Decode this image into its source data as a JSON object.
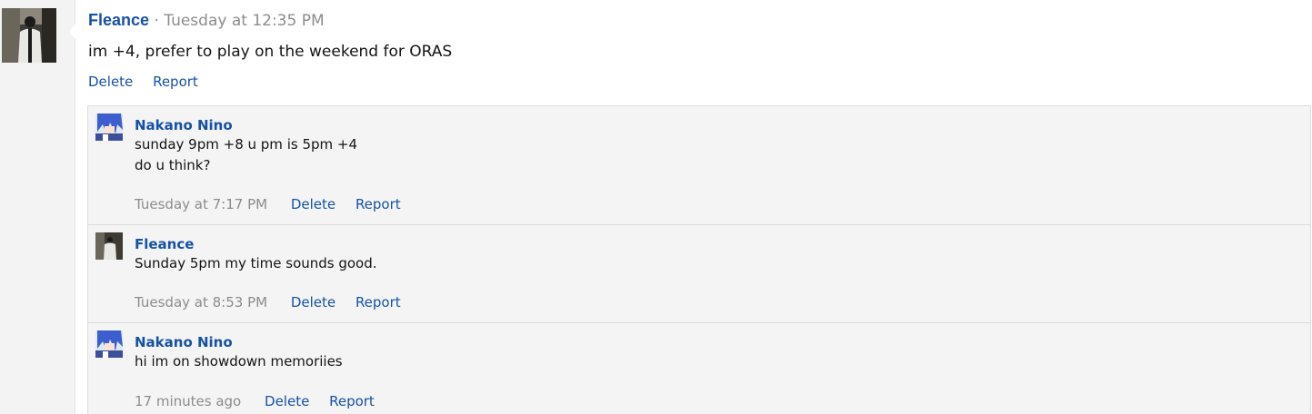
{
  "post": {
    "author": "Fleance",
    "separator": "·",
    "time": "Tuesday at 12:35 PM",
    "body": "im +4, prefer to play on the weekend for ORAS",
    "delete_label": "Delete",
    "report_label": "Report"
  },
  "comments": [
    {
      "author": "Nakano Nino",
      "lines": [
        "sunday 9pm +8 u pm is 5pm +4",
        "do u think?"
      ],
      "time": "Tuesday at 7:17 PM",
      "delete_label": "Delete",
      "report_label": "Report"
    },
    {
      "author": "Fleance",
      "lines": [
        "Sunday 5pm my time sounds good."
      ],
      "time": "Tuesday at 8:53 PM",
      "delete_label": "Delete",
      "report_label": "Report"
    },
    {
      "author": "Nakano Nino",
      "lines": [
        "hi im on showdown memoriies"
      ],
      "time": "17 minutes ago",
      "delete_label": "Delete",
      "report_label": "Report"
    }
  ],
  "colors": {
    "link": "#1652a4",
    "muted": "#8c8c8c",
    "comment_bg": "#f4f4f4"
  }
}
